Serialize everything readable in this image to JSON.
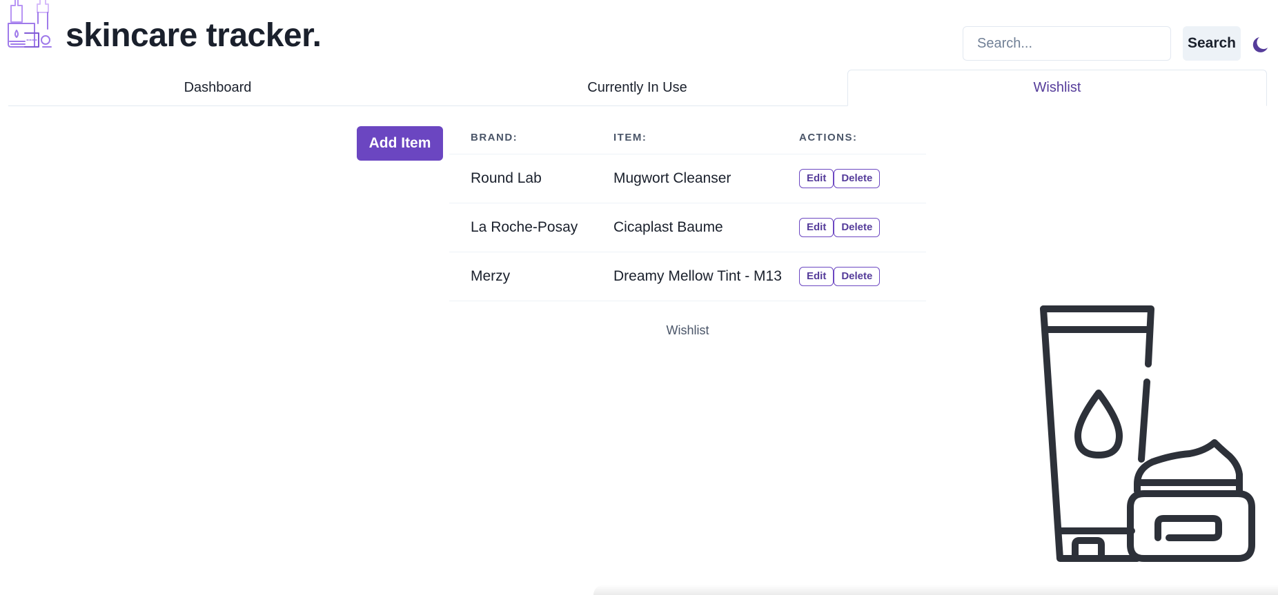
{
  "app": {
    "title": "skincare tracker.",
    "logo_icon": "skincare-bottles-icon",
    "illustration_icon": "tube-and-jar-icon"
  },
  "header": {
    "search_placeholder": "Search...",
    "search_value": "",
    "search_button_label": "Search",
    "theme_toggle_icon": "moon-icon"
  },
  "tabs": [
    {
      "label": "Dashboard",
      "active": false
    },
    {
      "label": "Currently In Use",
      "active": false
    },
    {
      "label": "Wishlist",
      "active": true
    }
  ],
  "toolbar": {
    "add_button_label": "Add Item"
  },
  "table": {
    "headers": {
      "brand": "Brand:",
      "item": "Item:",
      "actions": "Actions:"
    },
    "rows": [
      {
        "brand": "Round Lab",
        "item": "Mugwort Cleanser"
      },
      {
        "brand": "La Roche-Posay",
        "item": "Cicaplast Baume"
      },
      {
        "brand": "Merzy",
        "item": "Dreamy Mellow Tint - M13"
      }
    ],
    "edit_label": "Edit",
    "delete_label": "Delete",
    "caption": "Wishlist"
  },
  "colors": {
    "accent": "#6b46c1",
    "accent_text": "#553c9a",
    "text": "#1a202c",
    "muted": "#4a5568",
    "border": "#e2e8f0",
    "search_button_bg": "#edf2f7",
    "illustration_stroke": "#2d3139"
  }
}
